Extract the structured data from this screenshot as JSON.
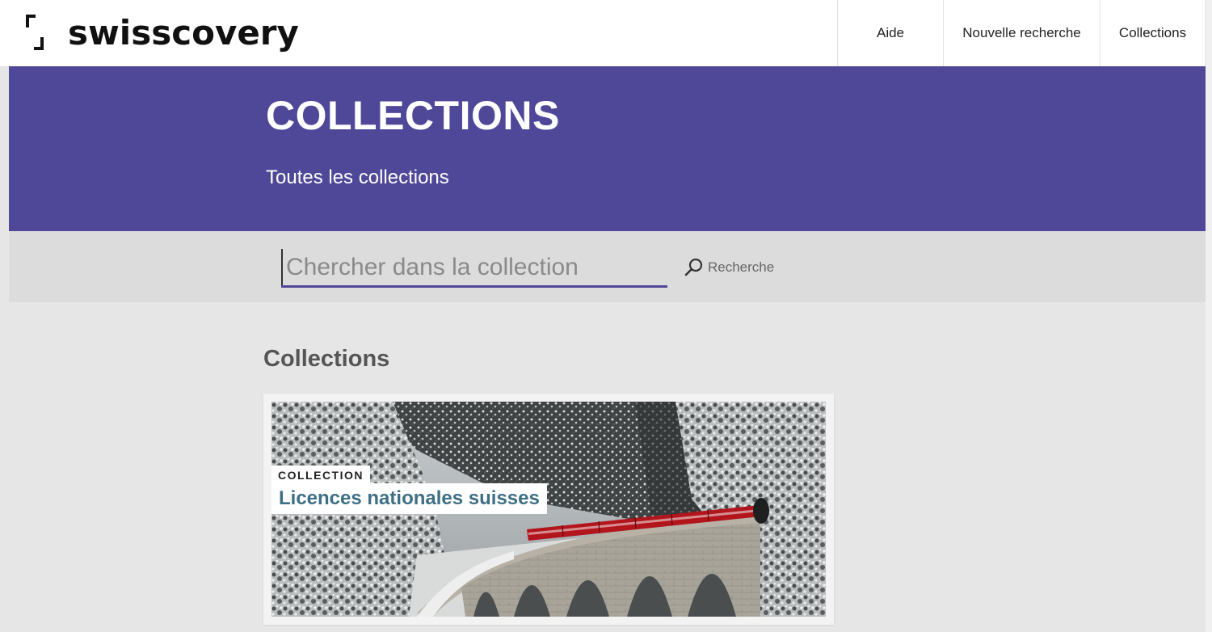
{
  "header": {
    "logo_text": "swisscovery",
    "nav": {
      "help": "Aide",
      "new_search": "Nouvelle recherche",
      "collections": "Collections"
    }
  },
  "banner": {
    "title": "COLLECTIONS",
    "subtitle": "Toutes les collections",
    "color": "#4f4899"
  },
  "search": {
    "placeholder": "Chercher dans la collection",
    "button_label": "Recherche"
  },
  "main": {
    "section_title": "Collections",
    "cards": [
      {
        "tag": "COLLECTION",
        "title": "Licences nationales suisses",
        "image": "snowy-mountain-viaduct-train"
      }
    ]
  },
  "colors": {
    "accent": "#4f4899",
    "title_link": "#3d6f85"
  }
}
